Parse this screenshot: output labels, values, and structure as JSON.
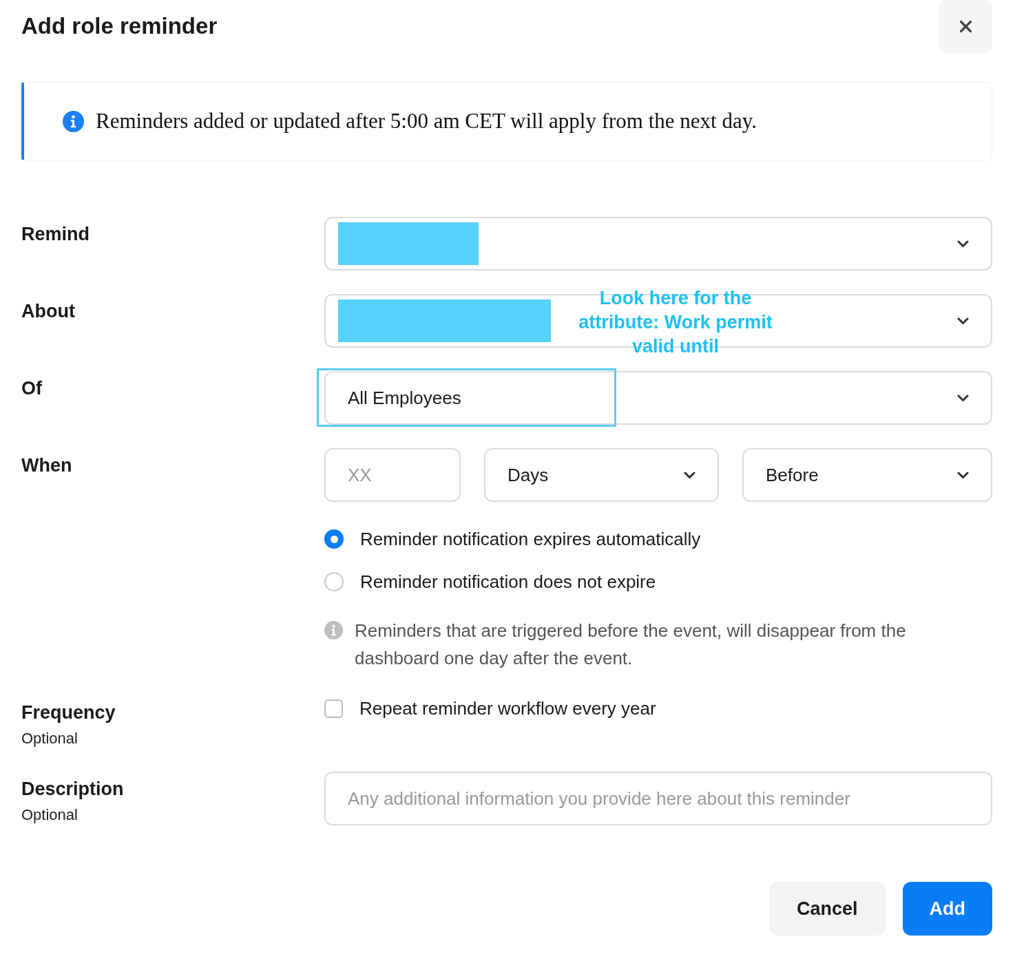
{
  "dialog": {
    "title": "Add role reminder"
  },
  "banner": {
    "text": "Reminders added or updated after 5:00 am CET will apply from the next day."
  },
  "rows": [
    {
      "kind": "select",
      "label": "Remind",
      "redaction": {
        "kind": "short"
      },
      "highlighted": false
    },
    {
      "kind": "select",
      "label": "About",
      "redaction": {
        "kind": "long"
      },
      "highlighted": false,
      "annotation": "Look here for the attribute: Work permit valid until"
    },
    {
      "kind": "select",
      "label": "Of",
      "value": "All Employees",
      "highlighted": true
    },
    {
      "kind": "when",
      "label": "When",
      "amount": {
        "placeholder": "XX"
      },
      "unit": {
        "value": "Days"
      },
      "relation": {
        "value": "Before"
      },
      "options": [
        {
          "label": "Reminder notification expires automatically",
          "selected": true
        },
        {
          "label": "Reminder notification does not expire",
          "selected": false
        }
      ],
      "note": "Reminders that are triggered before the event, will disappear from the dashboard one day after the event."
    },
    {
      "kind": "checkbox",
      "label": "Frequency",
      "sublabel": "Optional",
      "option": {
        "label": "Repeat reminder workflow every year",
        "checked": false
      }
    },
    {
      "kind": "text",
      "label": "Description",
      "sublabel": "Optional",
      "placeholder": "Any additional information you provide here about this reminder"
    }
  ],
  "buttons": [
    {
      "label": "Cancel",
      "kind": "secondary"
    },
    {
      "label": "Add",
      "kind": "primary"
    }
  ]
}
